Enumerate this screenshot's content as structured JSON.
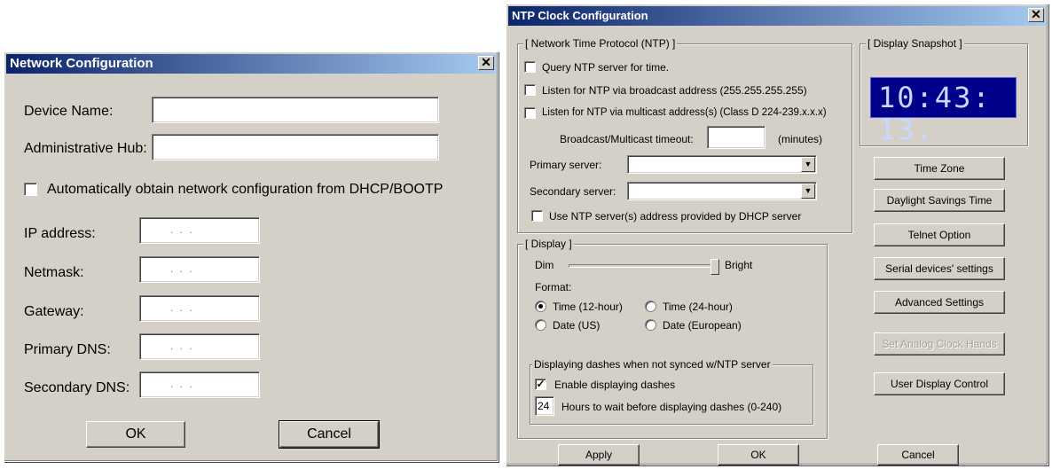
{
  "network_dialog": {
    "title": "Network Configuration",
    "close_glyph": "✕",
    "device_name_label": "Device Name:",
    "device_name_value": "",
    "admin_hub_label": "Administrative Hub:",
    "admin_hub_value": "",
    "dhcp_label": "Automatically obtain network configuration from DHCP/BOOTP",
    "dhcp_checked": false,
    "ip_label": "IP address:",
    "netmask_label": "Netmask:",
    "gateway_label": "Gateway:",
    "primary_dns_label": "Primary DNS:",
    "secondary_dns_label": "Secondary DNS:",
    "ip_dots": ". . .",
    "ok_label": "OK",
    "cancel_label": "Cancel"
  },
  "ntp_dialog": {
    "title": "NTP Clock Configuration",
    "close_glyph": "✕",
    "ntp_group": {
      "legend": "[ Network Time Protocol (NTP) ]",
      "query_label": "Query NTP server for time.",
      "broadcast_label": "Listen for NTP via broadcast address (255.255.255.255)",
      "multicast_label": "Listen for NTP via multicast address(s) (Class D 224-239.x.x.x)",
      "timeout_label": "Broadcast/Multicast timeout:",
      "timeout_value": "",
      "minutes_label": "(minutes)",
      "primary_label": "Primary server:",
      "primary_value": "",
      "secondary_label": "Secondary server:",
      "secondary_value": "",
      "dhcp_label": "Use NTP server(s) address  provided by DHCP server"
    },
    "snapshot": {
      "legend": "[ Display Snapshot ]",
      "time": "10:43: 13.",
      "bg_color": "#00008b",
      "digit_color": "#c8d8ff"
    },
    "display_group": {
      "legend": "[ Display ]",
      "dim_label": "Dim",
      "bright_label": "Bright",
      "brightness_fraction": 1.0,
      "format_label": "Format:",
      "time12_label": "Time (12-hour)",
      "time24_label": "Time (24-hour)",
      "date_us_label": "Date (US)",
      "date_eu_label": "Date (European)",
      "selected_format": "Time (12-hour)",
      "dashes_legend": "Displaying dashes when not synced w/NTP server",
      "enable_dashes_label": "Enable displaying dashes",
      "enable_dashes_checked": true,
      "hours_value": "24",
      "hours_label": "Hours to wait before displaying dashes (0-240)"
    },
    "side_buttons": {
      "time_zone": "Time Zone",
      "dst": "Daylight Savings Time",
      "telnet": "Telnet Option",
      "serial": "Serial devices' settings",
      "advanced": "Advanced Settings",
      "analog": "Set Analog Clock Hands",
      "user_display": "User Display Control"
    },
    "apply_label": "Apply",
    "ok_label": "OK",
    "cancel_label": "Cancel"
  },
  "colors": {
    "dialog_bg": "#d4d0c8",
    "title_start": "#0a246a",
    "title_end": "#a6caf0"
  }
}
